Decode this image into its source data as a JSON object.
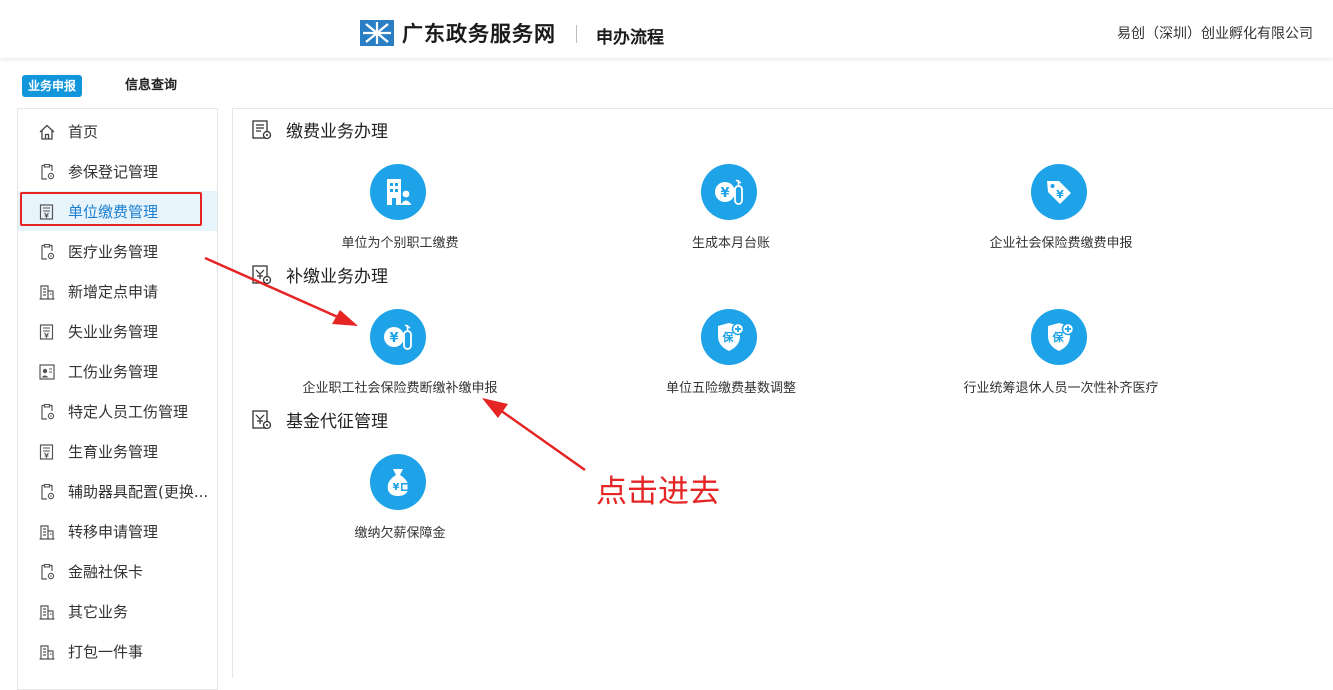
{
  "header": {
    "site_title": "广东政务服务网",
    "subtitle": "申办流程",
    "company": "易创（深圳）创业孵化有限公司"
  },
  "tabs": [
    {
      "label": "业务申报",
      "active": true
    },
    {
      "label": "信息查询",
      "active": false
    }
  ],
  "sidebar": {
    "items": [
      {
        "label": "首页",
        "icon": "home-icon"
      },
      {
        "label": "参保登记管理",
        "icon": "clipboard-gear-icon"
      },
      {
        "label": "单位缴费管理",
        "icon": "yuan-document-icon",
        "active": true
      },
      {
        "label": "医疗业务管理",
        "icon": "clipboard-gear-icon"
      },
      {
        "label": "新增定点申请",
        "icon": "building-icon"
      },
      {
        "label": "失业业务管理",
        "icon": "yuan-document-icon"
      },
      {
        "label": "工伤业务管理",
        "icon": "person-card-icon"
      },
      {
        "label": "特定人员工伤管理",
        "icon": "clipboard-gear-icon"
      },
      {
        "label": "生育业务管理",
        "icon": "yuan-document-icon"
      },
      {
        "label": "辅助器具配置(更换...",
        "icon": "clipboard-gear-icon"
      },
      {
        "label": "转移申请管理",
        "icon": "building-icon"
      },
      {
        "label": "金融社保卡",
        "icon": "clipboard-gear-icon"
      },
      {
        "label": "其它业务",
        "icon": "building-icon"
      },
      {
        "label": "打包一件事",
        "icon": "building-icon"
      }
    ]
  },
  "sections": [
    {
      "title": "缴费业务办理",
      "tiles": [
        {
          "label": "单位为个别职工缴费",
          "icon": "building-person-icon"
        },
        {
          "label": "生成本月台账",
          "icon": "yuan-bottle-icon"
        },
        {
          "label": "企业社会保险费缴费申报",
          "icon": "price-tag-icon"
        }
      ]
    },
    {
      "title": "补缴业务办理",
      "tiles": [
        {
          "label": "企业职工社会保险费断缴补缴申报",
          "icon": "yuan-bottle-icon"
        },
        {
          "label": "单位五险缴费基数调整",
          "icon": "insurance-shield-icon"
        },
        {
          "label": "行业统筹退休人员一次性补齐医疗",
          "icon": "insurance-shield-icon"
        }
      ]
    },
    {
      "title": "基金代征管理",
      "tiles": [
        {
          "label": "缴纳欠薪保障金",
          "icon": "money-bag-icon"
        }
      ]
    }
  ],
  "annotation": {
    "text": "点击进去",
    "color": "#e52424"
  },
  "colors": {
    "accent": "#1296db",
    "tile_circle": "#1ea3e8",
    "annotation": "#e52424"
  }
}
